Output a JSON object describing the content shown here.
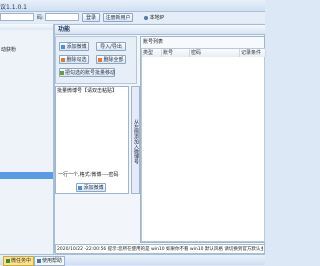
{
  "window": {
    "title": "议1.1.0.1"
  },
  "toolbar": {
    "password_label": "码:",
    "login_button": "登录",
    "register_button": "注册新用户",
    "local_option": "本地IP"
  },
  "left_pane": {
    "item_text": "动获粉"
  },
  "function_panel": {
    "title": "功能",
    "buttons": {
      "add_weibo": "添加微博",
      "import_export": "导入/导出",
      "delete_checked": "删除勾选",
      "delete_all": "删除全部",
      "move_checked": "把勾选的账号批量移动"
    }
  },
  "accounts_box": {
    "title": "批量微博号【请双击粘贴】",
    "hint": "一行一个,格式:微博----密码",
    "add_button": "添加微博"
  },
  "side_tab": {
    "label": "从左侧添加入微博号"
  },
  "account_list": {
    "title": "账号列表",
    "columns": [
      "类型",
      "账号",
      "密码",
      "记录条件"
    ]
  },
  "log": {
    "line": "2020/10/22 -22:00:56  提示:您所在使用的是 win10 如果你不看 win10 默认风格 请切换到官方默认主题,如果已经启"
  },
  "statusbar": {
    "tabs": [
      "微任务中",
      "使用帮助"
    ]
  },
  "colors": {
    "accent": "#2b6bd1",
    "panel_border": "#a6bcd7"
  }
}
